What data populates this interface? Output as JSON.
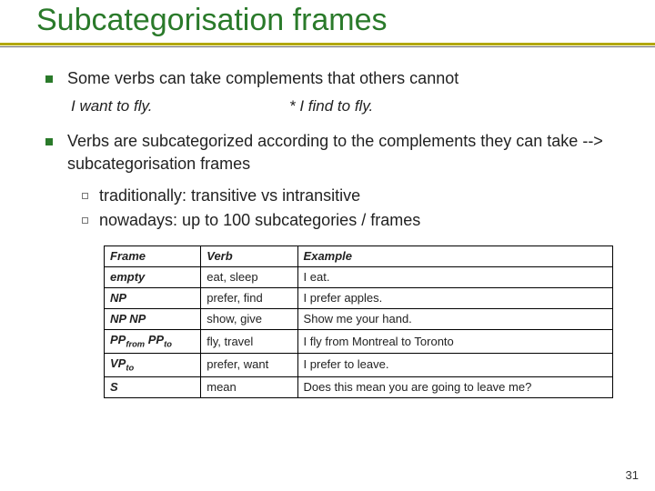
{
  "title": "Subcategorisation frames",
  "bullets": [
    "Some verbs can take complements that others cannot",
    "Verbs are subcategorized according to the complements they can take --> subcategorisation frames"
  ],
  "examples": {
    "left": "I want to fly.",
    "right": "* I find to fly."
  },
  "subbullets": [
    "traditionally: transitive vs intransitive",
    "nowadays: up to 100 subcategories / frames"
  ],
  "table": {
    "headers": [
      "Frame",
      "Verb",
      "Example"
    ],
    "rows": [
      {
        "frame_html": "empty",
        "verb": "eat, sleep",
        "example": "I eat."
      },
      {
        "frame_html": "NP",
        "verb": "prefer, find",
        "example": "I prefer apples."
      },
      {
        "frame_html": "NP NP",
        "verb": "show, give",
        "example": "Show me your hand."
      },
      {
        "frame_html": "PP<sub>from</sub> PP<sub>to</sub>",
        "verb": "fly, travel",
        "example": "I fly from Montreal to Toronto"
      },
      {
        "frame_html": "VP<sub>to</sub>",
        "verb": "prefer, want",
        "example": "I prefer to leave."
      },
      {
        "frame_html": "S",
        "verb": "mean",
        "example": "Does this mean you are going to leave me?"
      }
    ]
  },
  "pagenum": "31"
}
